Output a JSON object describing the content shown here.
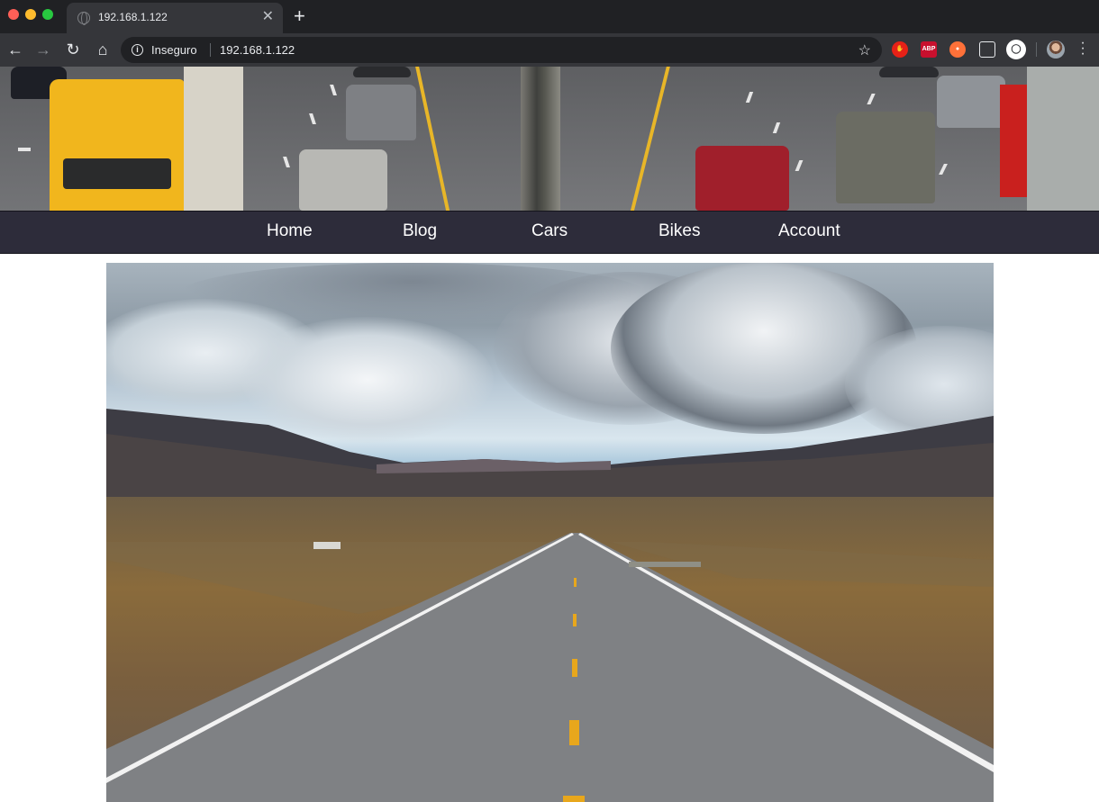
{
  "browser": {
    "tab": {
      "title": "192.168.1.122",
      "close_glyph": "✕"
    },
    "new_tab_glyph": "+",
    "toolbar": {
      "back_glyph": "←",
      "forward_glyph": "→",
      "reload_glyph": "↻",
      "home_glyph": "⌂",
      "security_label": "Inseguro",
      "url": "192.168.1.122",
      "bookmark_glyph": "☆",
      "extensions": [
        {
          "icon": "stop-hand-icon"
        },
        {
          "icon": "adblock-plus-icon",
          "label": "ABP"
        },
        {
          "icon": "fire-extension-icon"
        },
        {
          "icon": "glasses-extension-icon"
        },
        {
          "icon": "circle-extension-icon"
        }
      ],
      "menu_glyph": "⋮"
    }
  },
  "site": {
    "nav": {
      "items": [
        {
          "label": "Home"
        },
        {
          "label": "Blog"
        },
        {
          "label": "Cars"
        },
        {
          "label": "Bikes"
        },
        {
          "label": "Account"
        }
      ]
    },
    "banner_image": "highway-traffic-image",
    "hero_image": "desert-road-image"
  },
  "colors": {
    "navbar_bg": "#2d2c3a",
    "chrome_dark": "#202124",
    "chrome_toolbar": "#35363a"
  }
}
